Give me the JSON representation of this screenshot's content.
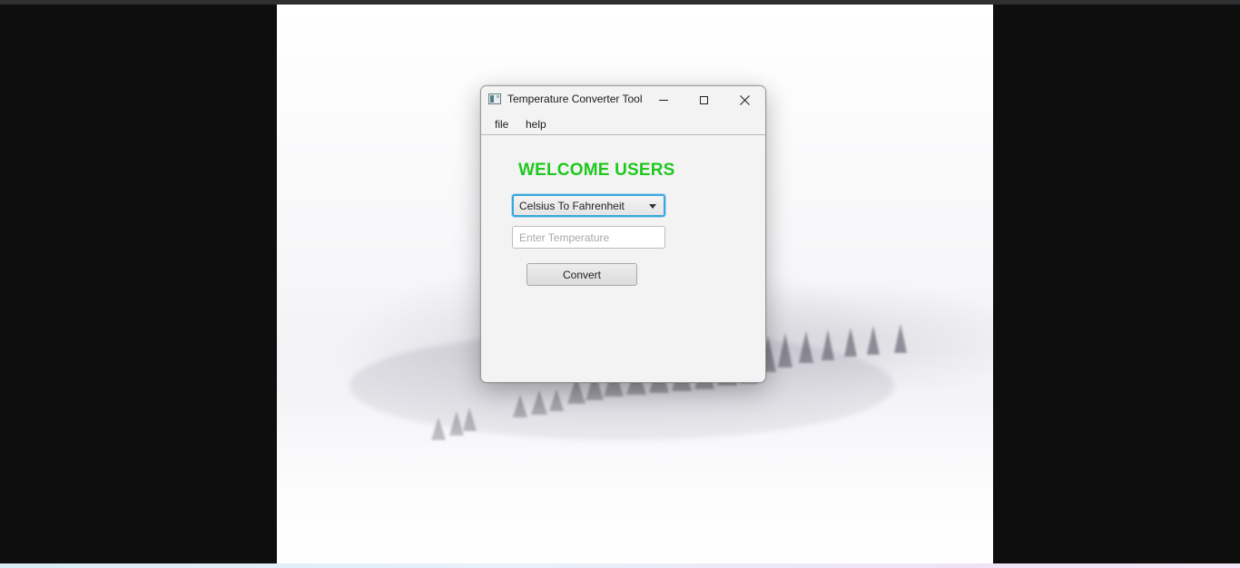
{
  "window": {
    "title": "Temperature Converter Tool",
    "icon": "app-window-icon",
    "controls": {
      "minimize": "minimize-icon",
      "maximize": "maximize-icon",
      "close": "close-icon"
    }
  },
  "menu": {
    "items": [
      {
        "label": "file"
      },
      {
        "label": "help"
      }
    ]
  },
  "content": {
    "heading": "WELCOME USERS",
    "heading_color": "#1ec81e",
    "conversion_select": {
      "selected": "Celsius To Fahrenheit",
      "focus_color": "#39a7de"
    },
    "temperature_input": {
      "value": "",
      "placeholder": "Enter Temperature"
    },
    "convert_button": {
      "label": "Convert"
    }
  }
}
